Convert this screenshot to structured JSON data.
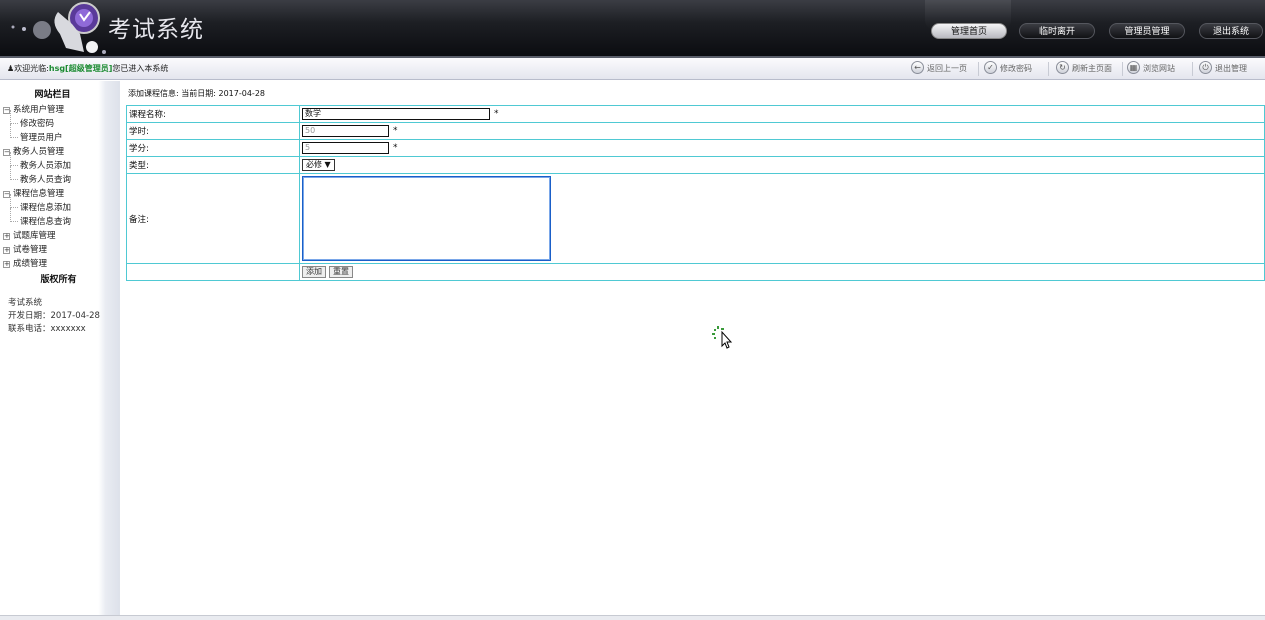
{
  "header": {
    "title": "考试系统",
    "nav": [
      "管理首页",
      "临时离开",
      "管理员管理",
      "退出系统"
    ]
  },
  "statusbar": {
    "welcome_prefix": "欢迎光临:",
    "username": "hsg[超级管理员]",
    "welcome_suffix": "您已进入本系统",
    "buttons": [
      {
        "label": "返回上一页",
        "icon": "back-arrow-icon"
      },
      {
        "label": "修改密码",
        "icon": "password-icon"
      },
      {
        "label": "刷新主页面",
        "icon": "refresh-icon"
      },
      {
        "label": "浏览网站",
        "icon": "browse-icon"
      },
      {
        "label": "退出管理",
        "icon": "power-icon"
      }
    ]
  },
  "sidebar": {
    "heading": "网站栏目",
    "tree": [
      {
        "label": "系统用户管理",
        "expanded": true,
        "children": [
          "修改密码",
          "管理员用户"
        ]
      },
      {
        "label": "教务人员管理",
        "expanded": true,
        "children": [
          "教务人员添加",
          "教务人员查询"
        ]
      },
      {
        "label": "课程信息管理",
        "expanded": true,
        "children": [
          "课程信息添加",
          "课程信息查询"
        ]
      },
      {
        "label": "试题库管理",
        "expanded": false,
        "children": []
      },
      {
        "label": "试卷管理",
        "expanded": false,
        "children": []
      },
      {
        "label": "成绩管理",
        "expanded": false,
        "children": []
      }
    ],
    "copyright": "版权所有",
    "info": [
      "考试系统",
      "开发日期：2017-04-28",
      "联系电话：xxxxxxx"
    ]
  },
  "content": {
    "crumb_label": "添加课程信息:",
    "date_label": "当前日期:",
    "date": "2017-04-28",
    "form": {
      "course_name_label": "课程名称:",
      "course_name_value": "数学",
      "hours_label": "学时:",
      "hours_value": "50",
      "credits_label": "学分:",
      "credits_value": "5",
      "type_label": "类型:",
      "type_value": "必修",
      "notes_label": "备注:",
      "notes_value": "",
      "required_mark": "*",
      "add_button": "添加",
      "reset_button": "重置"
    }
  },
  "colors": {
    "table_border": "#4fc9d3",
    "username": "#1c8b32",
    "header_bg": "#0b0c10"
  }
}
